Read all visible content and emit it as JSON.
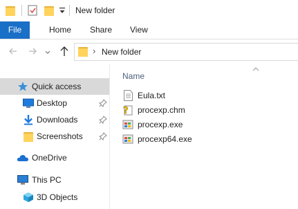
{
  "window": {
    "title": "New folder"
  },
  "ribbon": {
    "tabs": [
      "File",
      "Home",
      "Share",
      "View"
    ]
  },
  "address": {
    "path_segment": "New folder",
    "separator": "›"
  },
  "sidebar": {
    "quick_access": "Quick access",
    "items": [
      {
        "label": "Desktop",
        "icon": "desktop-icon",
        "pinned": true
      },
      {
        "label": "Downloads",
        "icon": "downloads-icon",
        "pinned": true
      },
      {
        "label": "Screenshots",
        "icon": "folder-icon",
        "pinned": true
      }
    ],
    "onedrive": "OneDrive",
    "this_pc": "This PC",
    "objects": "3D Objects"
  },
  "content": {
    "column_header": "Name",
    "files": [
      {
        "name": "Eula.txt",
        "icon": "text-file-icon"
      },
      {
        "name": "procexp.chm",
        "icon": "help-file-icon"
      },
      {
        "name": "procexp.exe",
        "icon": "exe-file-icon"
      },
      {
        "name": "procexp64.exe",
        "icon": "exe-file-icon"
      }
    ]
  },
  "colors": {
    "accent": "#1a6fc6",
    "selection": "#cce8ff",
    "quick_access_bg": "#d9d9d9",
    "folder": "#ffd35c"
  }
}
